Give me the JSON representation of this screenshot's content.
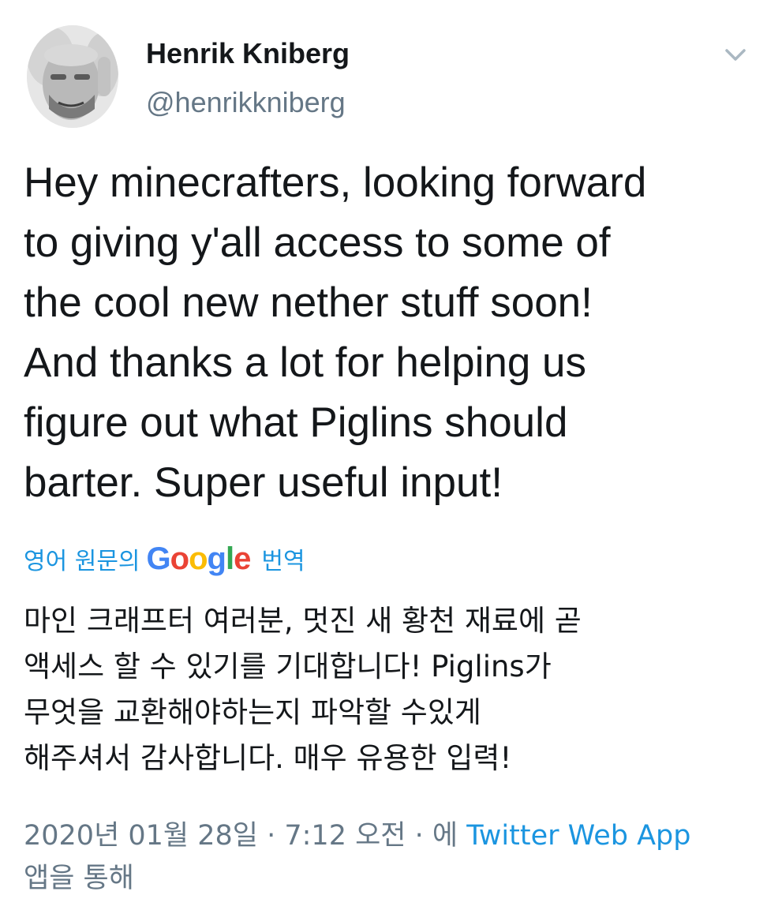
{
  "author": {
    "name": "Henrik Kniberg",
    "handle": "@henrikkniberg"
  },
  "icons": {
    "avatar": "avatar-photo",
    "menu": "chevron-down-icon",
    "translate_brand": "google-logo"
  },
  "tweet": {
    "lines": [
      "Hey minecrafters, looking forward",
      "to giving y'all access to some of",
      "the cool new nether stuff soon!",
      "And thanks a lot for helping us",
      "figure out what Piglins should",
      "barter. Super useful input!"
    ]
  },
  "translation": {
    "prefix": "영어 원문의",
    "brand": {
      "G": "G",
      "o1": "o",
      "o2": "o",
      "g": "g",
      "l": "l",
      "e": "e"
    },
    "suffix": "번역",
    "lines": [
      "마인 크래프터 여러분, 멋진 새 황천 재료에 곧",
      "액세스 할 수 있기를 기대합니다! Piglins가",
      "무엇을 교환해야하는지 파악할 수있게",
      "해주셔서 감사합니다. 매우 유용한 입력!"
    ]
  },
  "meta": {
    "timestamp": "2020년 01월 28일 · 7:12 오전 · 에",
    "source": "Twitter Web App",
    "via": "앱을 통해"
  },
  "colors": {
    "text": "#14171a",
    "secondary": "#657786",
    "link": "#1b95e0",
    "google_blue": "#4285F4",
    "google_red": "#EA4335",
    "google_yellow": "#FBBC05",
    "google_green": "#34A853"
  }
}
